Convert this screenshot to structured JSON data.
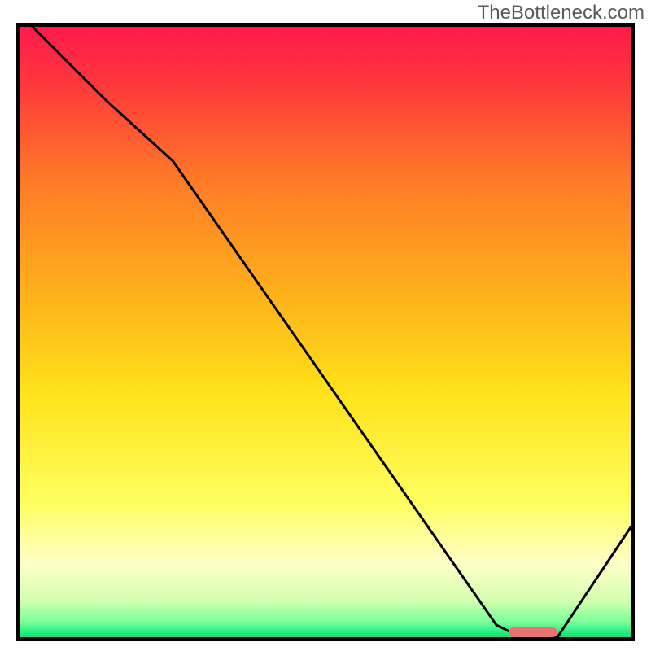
{
  "watermark": "TheBottleneck.com",
  "chart_data": {
    "type": "line",
    "title": "",
    "xlabel": "",
    "ylabel": "",
    "xlim": [
      0,
      100
    ],
    "ylim": [
      0,
      100
    ],
    "grid": false,
    "background_gradient": {
      "stops": [
        {
          "offset": 0.0,
          "color": "#ff1a4b"
        },
        {
          "offset": 0.1,
          "color": "#ff3a3a"
        },
        {
          "offset": 0.25,
          "color": "#ff7a28"
        },
        {
          "offset": 0.45,
          "color": "#ffb41a"
        },
        {
          "offset": 0.6,
          "color": "#ffe21a"
        },
        {
          "offset": 0.78,
          "color": "#ffff60"
        },
        {
          "offset": 0.88,
          "color": "#ffffc8"
        },
        {
          "offset": 0.94,
          "color": "#d4ffb0"
        },
        {
          "offset": 0.975,
          "color": "#7aff9a"
        },
        {
          "offset": 1.0,
          "color": "#00e676"
        }
      ]
    },
    "series": [
      {
        "name": "bottleneck-curve",
        "x": [
          2,
          14,
          25,
          78,
          82,
          88,
          100
        ],
        "y": [
          100,
          88,
          78,
          2,
          0,
          0,
          18
        ]
      }
    ],
    "marker": {
      "name": "optimal-range",
      "x_start": 80,
      "x_end": 88,
      "y": 0.8,
      "color": "#e9736f"
    },
    "frame_color": "#000000",
    "frame_width": 5,
    "line_color": "#000000",
    "line_width": 3
  }
}
